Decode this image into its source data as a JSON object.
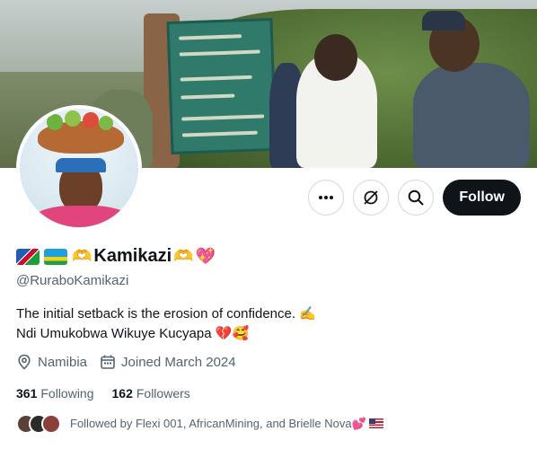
{
  "profile": {
    "display_name": "Kamikazi",
    "name_emojis_before": [
      "flag-namibia",
      "flag-rwanda",
      "heart-hands"
    ],
    "name_emojis_after": [
      "heart-hands",
      "sparkling-heart"
    ],
    "handle": "@RuraboKamikazi",
    "bio_line1": "The initial setback is the erosion of confidence.",
    "bio_line1_emoji": "✍️",
    "bio_line2": "Ndi Umukobwa Wikuye Kucyapa",
    "bio_line2_emojis": "💔🥰",
    "location": "Namibia",
    "joined": "Joined March 2024"
  },
  "actions": {
    "more_icon": "more-icon",
    "grok_icon": "grok-icon",
    "search_icon": "search-icon",
    "follow_label": "Follow"
  },
  "stats": {
    "following_count": "361",
    "following_label": "Following",
    "followers_count": "162",
    "followers_label": "Followers"
  },
  "followed_by": {
    "text": "Followed by Flexi 001, AfricanMining, and Brielle Nova",
    "emoji": "💕"
  },
  "colors": {
    "follow_bg": "#0f1419",
    "secondary_text": "#536471",
    "border": "#cfd9de"
  }
}
